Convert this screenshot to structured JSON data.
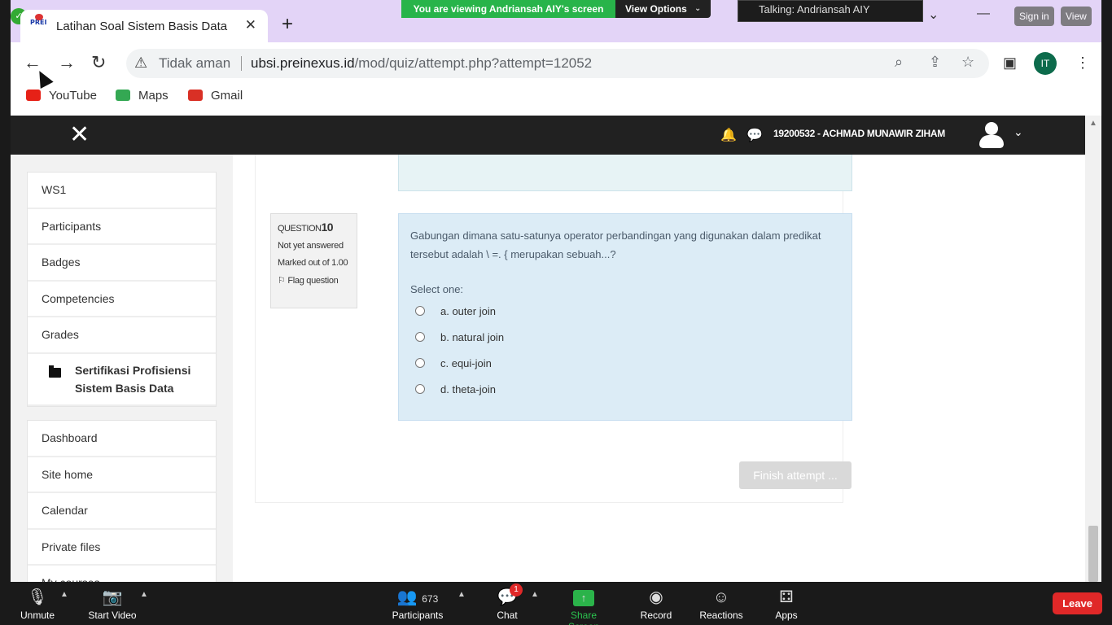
{
  "browser": {
    "tab_title": "Latihan Soal Sistem Basis Data",
    "tab_favicon_text": "PREI",
    "not_secure": "Tidak aman",
    "url_host": "ubsi.preinexus.id",
    "url_path": "/mod/quiz/attempt.php?attempt=12052",
    "profile_initials": "IT",
    "bookmarks": [
      {
        "label": "YouTube",
        "color": "#e62117"
      },
      {
        "label": "Maps",
        "color": "#34a853"
      },
      {
        "label": "Gmail",
        "color": "#d93025"
      }
    ]
  },
  "site": {
    "user_label": "19200532 - ACHMAD MUNAWIR ZIHAM",
    "drawer_top": [
      "WS1",
      "Participants",
      "Badges",
      "Competencies",
      "Grades"
    ],
    "drawer_active": "Sertifikasi Profisiensi Sistem Basis Data",
    "drawer_bottom": [
      "Dashboard",
      "Site home",
      "Calendar",
      "Private files",
      "My courses"
    ]
  },
  "question": {
    "prefix": "QUESTION",
    "number": "10",
    "state": "Not yet answered",
    "marks": "Marked out of 1.00",
    "flag": "Flag question",
    "text": "Gabungan dimana satu-satunya operator perbandingan yang digunakan dalam predikat tersebut adalah \\ =. { merupakan sebuah...?",
    "select_label": "Select one:",
    "options": [
      "a. outer join",
      "b. natural join",
      "c. equi-join",
      "d. theta-join"
    ],
    "finish_label": "Finish attempt ..."
  },
  "zoom": {
    "viewing": "You are viewing Andriansah AIY's screen",
    "view_options": "View Options",
    "talking": "Talking: Andriansah AIY",
    "sign_in": "Sign in",
    "view": "View",
    "controls": {
      "unmute": "Unmute",
      "start_video": "Start Video",
      "participants": "Participants",
      "participants_count": "673",
      "chat": "Chat",
      "chat_badge": "1",
      "share": "Share Screen",
      "record": "Record",
      "reactions": "Reactions",
      "apps": "Apps",
      "leave": "Leave"
    }
  }
}
